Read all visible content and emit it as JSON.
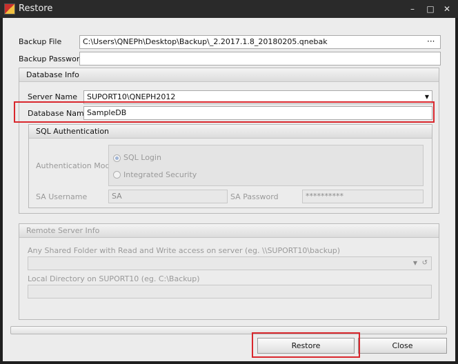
{
  "window": {
    "title": "Restore"
  },
  "backup": {
    "file_label": "Backup File",
    "file_value": "C:\\Users\\QNEPh\\Desktop\\Backup\\_2.2017.1.8_20180205.qnebak",
    "browse_label": "···",
    "password_label": "Backup Password",
    "password_value": ""
  },
  "database_info": {
    "header": "Database Info",
    "server_label": "Server Name",
    "server_value": "SUPORT10\\QNEPH2012",
    "dbname_label": "Database Name",
    "dbname_value": "SampleDB",
    "sql_auth": {
      "header": "SQL Authentication",
      "mode_label": "Authentication Mode",
      "option_sql": "SQL Login",
      "option_integrated": "Integrated Security",
      "sa_user_label": "SA Username",
      "sa_user_value": "SA",
      "sa_pass_label": "SA Password",
      "sa_pass_value": "**********"
    }
  },
  "remote": {
    "header": "Remote Server Info",
    "shared_label": "Any Shared Folder with Read and Write access on server (eg. \\\\SUPORT10\\backup)",
    "local_label": "Local Directory on SUPORT10 (eg. C:\\Backup)"
  },
  "buttons": {
    "restore": "Restore",
    "close": "Close"
  },
  "colors": {
    "highlight": "#d9262c"
  }
}
